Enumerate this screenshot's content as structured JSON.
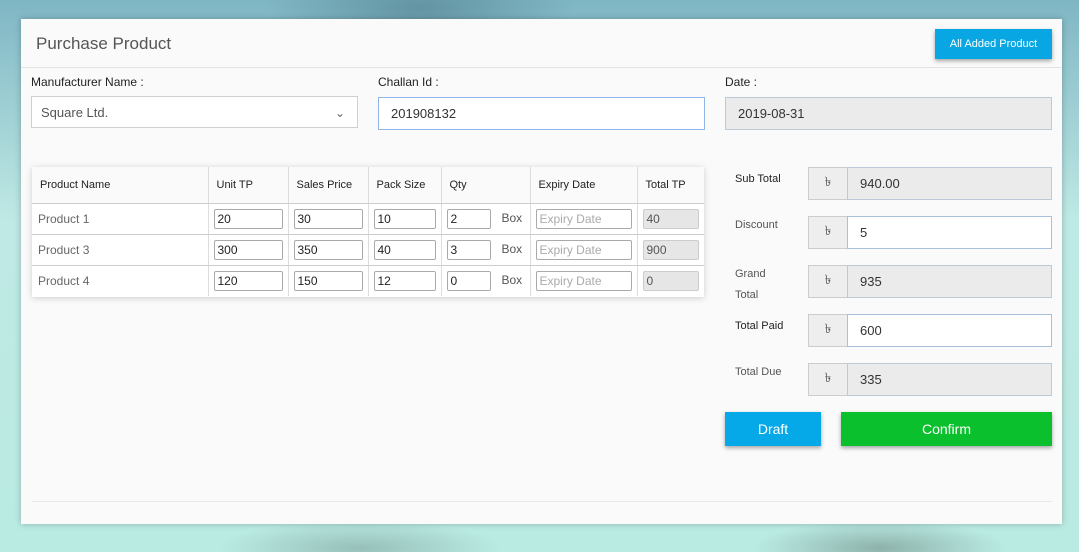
{
  "header": {
    "title": "Purchase Product",
    "all_added_label": "All Added Product"
  },
  "form": {
    "manufacturer_label": "Manufacturer Name :",
    "manufacturer_value": "Square Ltd.",
    "challan_label": "Challan Id :",
    "challan_value": "201908132",
    "date_label": "Date :",
    "date_value": "2019-08-31"
  },
  "table": {
    "headers": [
      "Product Name",
      "Unit TP",
      "Sales Price",
      "Pack Size",
      "Qty",
      "Expiry Date",
      "Total TP"
    ],
    "expiry_placeholder": "Expiry Date",
    "unit_label": "Box",
    "rows": [
      {
        "name": "Product 1",
        "unit_tp": "20",
        "sales_price": "30",
        "pack_size": "10",
        "qty": "2",
        "total_tp": "40"
      },
      {
        "name": "Product 3",
        "unit_tp": "300",
        "sales_price": "350",
        "pack_size": "40",
        "qty": "3",
        "total_tp": "900"
      },
      {
        "name": "Product 4",
        "unit_tp": "120",
        "sales_price": "150",
        "pack_size": "12",
        "qty": "0",
        "total_tp": "0"
      }
    ]
  },
  "totals": {
    "currency_symbol": "৳",
    "sub_total_label": "Sub Total",
    "sub_total_value": "940.00",
    "discount_label": "Discount",
    "discount_value": "5",
    "grand_total_label_1": "Grand",
    "grand_total_label_2": "Total",
    "grand_total_value": "935",
    "total_paid_label": "Total Paid",
    "total_paid_value": "600",
    "total_due_label": "Total Due",
    "total_due_value": "335"
  },
  "actions": {
    "draft_label": "Draft",
    "confirm_label": "Confirm"
  },
  "colors": {
    "primary_button": "#08a7e3",
    "confirm_button": "#0ac12d"
  }
}
